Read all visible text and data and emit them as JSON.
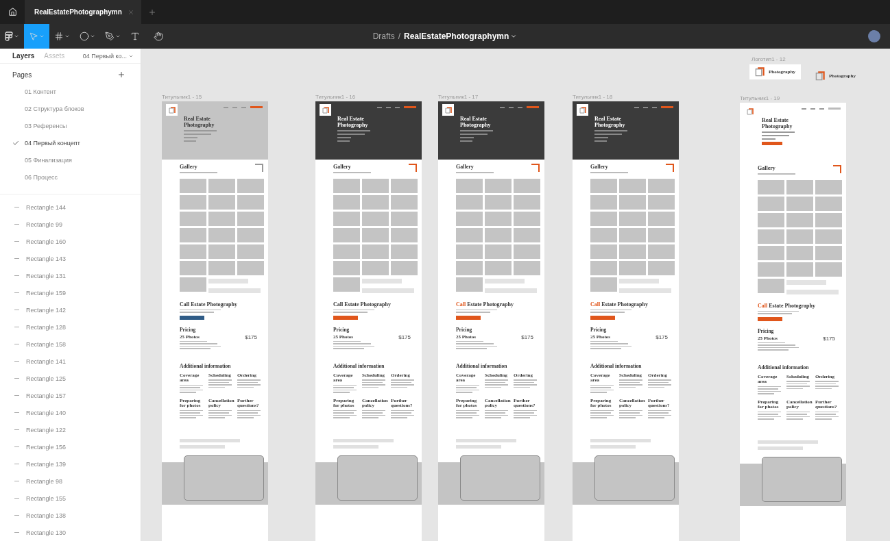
{
  "tab_bar": {
    "tabs": [
      {
        "label": "RealEstatePhotographymn",
        "selected": true
      }
    ]
  },
  "toolbar": {
    "tools": [
      {
        "kind": "menu",
        "selected": false,
        "dropdown": true
      },
      {
        "kind": "move",
        "selected": true,
        "dropdown": true
      },
      {
        "kind": "frame",
        "selected": false,
        "dropdown": true
      },
      {
        "kind": "ellipse",
        "selected": false,
        "dropdown": true
      },
      {
        "kind": "pen",
        "selected": false,
        "dropdown": true
      },
      {
        "kind": "text",
        "selected": false,
        "dropdown": false
      },
      {
        "kind": "hand",
        "selected": false,
        "dropdown": false
      }
    ],
    "breadcrumb": {
      "folder": "Drafts",
      "separator": "/",
      "file": "RealEstatePhotographymn"
    }
  },
  "sidebar": {
    "tabs": [
      {
        "label": "Layers",
        "selected": true
      },
      {
        "label": "Assets",
        "selected": false
      }
    ],
    "page_dropdown": "04 Первый ко...",
    "pages_title": "Pages",
    "pages": [
      {
        "label": "01 Контент",
        "selected": false
      },
      {
        "label": "02 Структура блоков",
        "selected": false
      },
      {
        "label": "03 Референсы",
        "selected": false
      },
      {
        "label": "04 Первый концепт",
        "selected": true
      },
      {
        "label": "05 Финализация",
        "selected": false
      },
      {
        "label": "06 Процесс",
        "selected": false
      }
    ],
    "layers": [
      "Rectangle 144",
      "Rectangle 99",
      "Rectangle 160",
      "Rectangle 143",
      "Rectangle 131",
      "Rectangle 159",
      "Rectangle 142",
      "Rectangle 128",
      "Rectangle 158",
      "Rectangle 141",
      "Rectangle 125",
      "Rectangle 157",
      "Rectangle 140",
      "Rectangle 122",
      "Rectangle 156",
      "Rectangle 139",
      "Rectangle 98",
      "Rectangle 155",
      "Rectangle 138",
      "Rectangle 130"
    ]
  },
  "canvas": {
    "logo_frame": {
      "label": "Логотип1 - 12",
      "logos": [
        {
          "kind": "boxed",
          "text": "Photography"
        },
        {
          "kind": "plain",
          "text": "Photography"
        }
      ]
    },
    "frames": [
      {
        "label": "Титульник1 - 15",
        "kind": "grey",
        "orange_accent": false,
        "call_highlight": false,
        "title": "Real Estate Photography",
        "gallery": "Gallery",
        "call_lead": "Call",
        "call_rest": "Estate Photography",
        "pricing": "Pricing",
        "package": "25 Photos",
        "price": "$175",
        "info_title": "Additional information",
        "info": [
          "Coverage area",
          "Scheduling",
          "Ordering",
          "Preparing for photos",
          "Cancellation policy",
          "Further questions?"
        ]
      },
      {
        "label": "Титульник1 - 16",
        "kind": "dark",
        "orange_accent": true,
        "call_highlight": false,
        "title": "Real Estate Photography",
        "gallery": "Gallery",
        "call_lead": "Call",
        "call_rest": "Estate Photography",
        "pricing": "Pricing",
        "package": "25 Photos",
        "price": "$175",
        "info_title": "Additional information",
        "info": [
          "Coverage area",
          "Scheduling",
          "Ordering",
          "Preparing for photos",
          "Cancellation policy",
          "Further questions?"
        ]
      },
      {
        "label": "Титульник1 - 17",
        "kind": "dark",
        "orange_accent": true,
        "call_highlight": true,
        "title": "Real Estate Photography",
        "gallery": "Gallery",
        "call_lead": "Call",
        "call_rest": "Estate Photography",
        "pricing": "Pricing",
        "package": "25 Photos",
        "price": "$175",
        "info_title": "Additional information",
        "info": [
          "Coverage area",
          "Scheduling",
          "Ordering",
          "Preparing for photos",
          "Cancellation policy",
          "Further questions?"
        ]
      },
      {
        "label": "Титульник1 - 18",
        "kind": "dark",
        "orange_accent": true,
        "call_highlight": true,
        "title": "Real Estate Photography",
        "gallery": "Gallery",
        "call_lead": "Call",
        "call_rest": "Estate Photography",
        "pricing": "Pricing",
        "package": "25 Photos",
        "price": "$175",
        "info_title": "Additional information",
        "info": [
          "Coverage area",
          "Scheduling",
          "Ordering",
          "Preparing for photos",
          "Cancellation policy",
          "Further questions?"
        ]
      },
      {
        "label": "Титульник1 - 19",
        "kind": "light",
        "orange_accent": true,
        "call_highlight": true,
        "title": "Real Estate Photography",
        "gallery": "Gallery",
        "call_lead": "Call",
        "call_rest": "Estate Photography",
        "pricing": "Pricing",
        "package": "25 Photos",
        "price": "$175",
        "info_title": "Additional information",
        "info": [
          "Coverage area",
          "Scheduling",
          "Ordering",
          "Preparing for photos",
          "Cancellation policy",
          "Further questions?"
        ]
      }
    ]
  }
}
